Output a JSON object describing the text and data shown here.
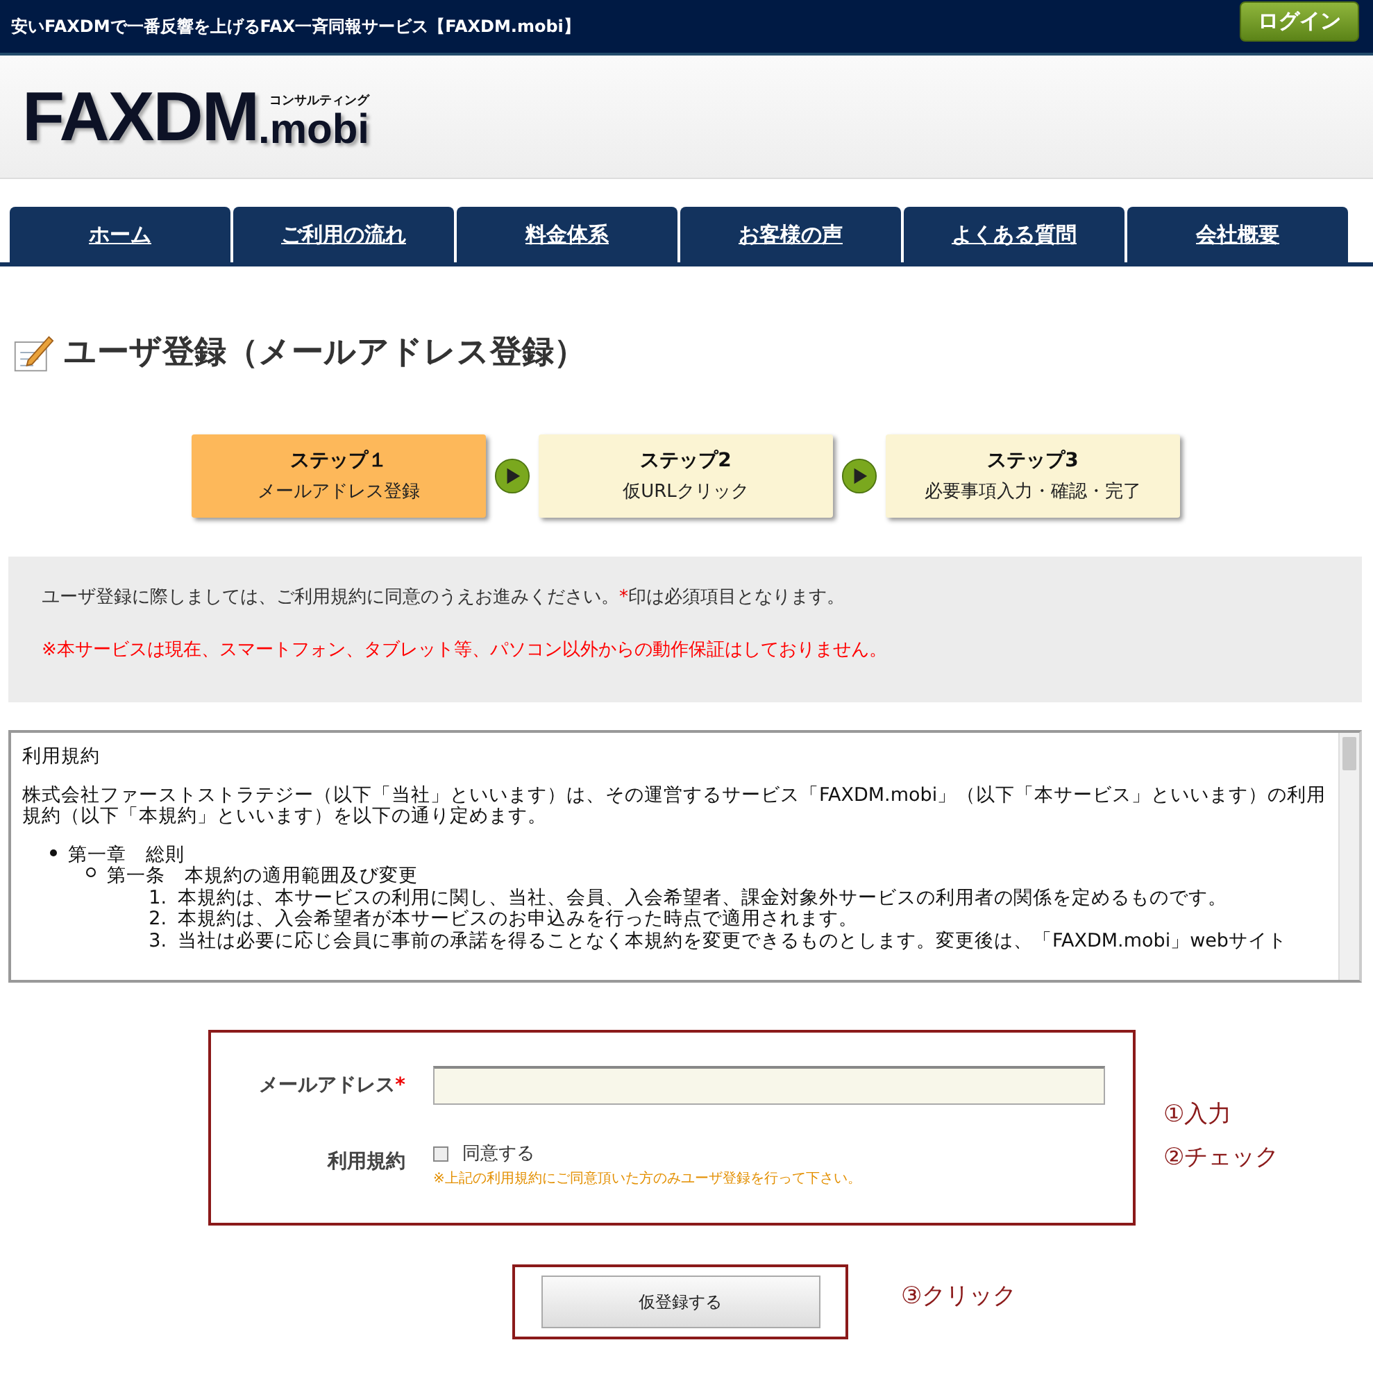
{
  "top_bar": {
    "tagline": "安いFAXDMで一番反響を上げるFAX一斉同報サービス【FAXDM.mobi】",
    "login_button": "ログイン"
  },
  "logo": {
    "main": "FAXDM",
    "suffix": ".mobi",
    "subtitle": "コンサルティング"
  },
  "nav": [
    {
      "label": "ホーム"
    },
    {
      "label": "ご利用の流れ"
    },
    {
      "label": "料金体系"
    },
    {
      "label": "お客様の声"
    },
    {
      "label": "よくある質問"
    },
    {
      "label": "会社概要"
    }
  ],
  "page_title": "ユーザ登録（メールアドレス登録）",
  "steps": [
    {
      "title": "ステップ１",
      "label": "メールアドレス登録",
      "selected": true
    },
    {
      "title": "ステップ2",
      "label": "仮URLクリック",
      "selected": false
    },
    {
      "title": "ステップ3",
      "label": "必要事項入力・確認・完了",
      "selected": false
    }
  ],
  "notice": {
    "text_before": "ユーザ登録に際しましては、ご利用規約に同意のうえお進みください。",
    "mark": "*",
    "text_after": "印は必須項目となります。",
    "warning": "※本サービスは現在、スマートフォン、タブレット等、パソコン以外からの動作保証はしておりません。"
  },
  "terms": {
    "heading": "利用規約",
    "intro": "株式会社ファーストストラテジー（以下「当社」といいます）は、その運営するサービス「FAXDM.mobi」（以下「本サービス」といいます）の利用規約（以下「本規約」といいます）を以下の通り定めます。",
    "items": [
      {
        "text": "第一章　総則",
        "children": [
          {
            "text": "第一条　本規約の適用範囲及び変更",
            "children": [
              {
                "number": "1.",
                "text": "本規約は、本サービスの利用に関し、当社、会員、入会希望者、課金対象外サービスの利用者の関係を定めるものです。"
              },
              {
                "number": "2.",
                "text": "本規約は、入会希望者が本サービスのお申込みを行った時点で適用されます。"
              },
              {
                "number": "3.",
                "text": "当社は必要に応じ会員に事前の承諾を得ることなく本規約を変更できるものとします。変更後は、「FAXDM.mobi」webサイト"
              }
            ]
          }
        ]
      }
    ]
  },
  "form": {
    "email": {
      "label": "メールアドレス",
      "required_mark": "*"
    },
    "agree": {
      "label": "利用規約",
      "checkbox_label": "同意する",
      "checked": false,
      "note": "※上記の利用規約にご同意頂いた方のみユーザ登録を行って下さい。"
    },
    "submit": "仮登録する"
  },
  "annotations": {
    "step1": "①入力",
    "step2": "②チェック",
    "step3": "③クリック"
  }
}
